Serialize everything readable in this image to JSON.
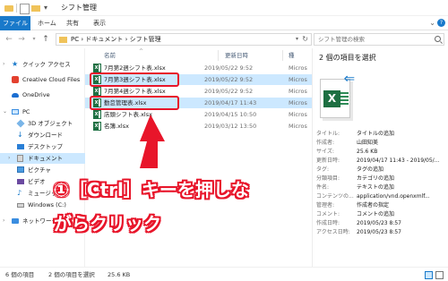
{
  "window": {
    "title": "シフト管理"
  },
  "ribbon": {
    "tabs": [
      "ファイル",
      "ホーム",
      "共有",
      "表示"
    ]
  },
  "address": {
    "path": "PC  ›  ドキュメント  ›  シフト管理",
    "search_placeholder": "シフト管理の検索"
  },
  "sidebar": {
    "items": [
      {
        "label": "クイック アクセス",
        "icon": "star-icon"
      },
      {
        "label": "Creative Cloud Files",
        "icon": "creative-cloud-icon"
      },
      {
        "label": "OneDrive",
        "icon": "onedrive-icon"
      },
      {
        "label": "PC",
        "icon": "pc-icon"
      },
      {
        "label": "3D オブジェクト",
        "icon": "3d-objects-icon"
      },
      {
        "label": "ダウンロード",
        "icon": "download-icon"
      },
      {
        "label": "デスクトップ",
        "icon": "desktop-icon"
      },
      {
        "label": "ドキュメント",
        "icon": "documents-icon"
      },
      {
        "label": "ピクチャ",
        "icon": "pictures-icon"
      },
      {
        "label": "ビデオ",
        "icon": "videos-icon"
      },
      {
        "label": "ミュージック",
        "icon": "music-icon"
      },
      {
        "label": "Windows (C:)",
        "icon": "drive-icon"
      },
      {
        "label": "ネットワーク",
        "icon": "network-icon"
      }
    ]
  },
  "filelist": {
    "columns": [
      "名前",
      "更新日時",
      "種"
    ],
    "files": [
      {
        "name": "7月第2週シフト表.xlsx",
        "date": "2019/05/22 9:52",
        "type": "Micros"
      },
      {
        "name": "7月第3週シフト表.xlsx",
        "date": "2019/05/22 9:52",
        "type": "Micros"
      },
      {
        "name": "7月第4週シフト表.xlsx",
        "date": "2019/05/22 9:52",
        "type": "Micros"
      },
      {
        "name": "勤怠管理表.xlsx",
        "date": "2019/04/17 11:43",
        "type": "Micros"
      },
      {
        "name": "店頭シフト表.xlsx",
        "date": "2019/04/15 10:50",
        "type": "Micros"
      },
      {
        "name": "名簿.xlsx",
        "date": "2019/03/12 13:50",
        "type": "Micros"
      }
    ]
  },
  "details": {
    "title": "2 個の項目を選択",
    "properties": [
      {
        "key": "タイトル:",
        "value": "タイトルの追加"
      },
      {
        "key": "作成者:",
        "value": "山田知美"
      },
      {
        "key": "サイズ:",
        "value": "25.6 KB"
      },
      {
        "key": "更新日時:",
        "value": "2019/04/17 11:43 - 2019/05/..."
      },
      {
        "key": "タグ:",
        "value": "タグの追加"
      },
      {
        "key": "分類項目:",
        "value": "カテゴリの追加"
      },
      {
        "key": "件名:",
        "value": "テキストの追加"
      },
      {
        "key": "コンテンツの...",
        "value": "application/vnd.openxmlf..."
      },
      {
        "key": "管理者:",
        "value": "作成者の指定"
      },
      {
        "key": "コメント:",
        "value": "コメントの追加"
      },
      {
        "key": "作成日時:",
        "value": "2019/05/23 8:57"
      },
      {
        "key": "アクセス日時:",
        "value": "2019/05/23 8:57"
      }
    ]
  },
  "status": {
    "count": "6 個の項目",
    "selection": "2 個の項目を選択",
    "size": "25.6 KB"
  },
  "annotation": {
    "line1": "①［Ctrl］キーを押しな",
    "line2": "がらクリック",
    "color": "#e8152a"
  },
  "colors": {
    "accent": "#1979ca",
    "selection": "#cce8ff",
    "excel_green": "#1d6f42"
  }
}
